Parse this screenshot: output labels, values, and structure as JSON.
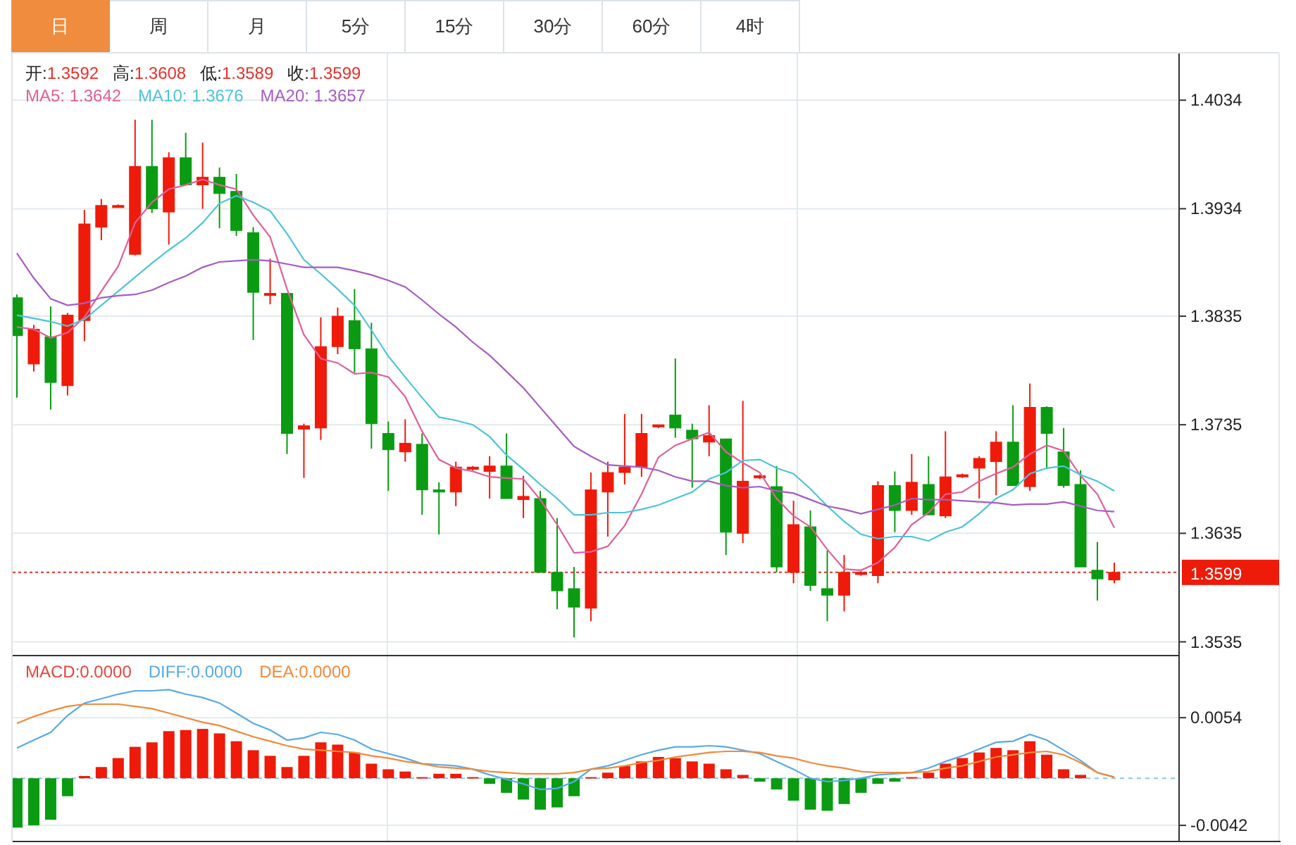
{
  "tabs": [
    {
      "label": "日",
      "selected": true
    },
    {
      "label": "周",
      "selected": false
    },
    {
      "label": "月",
      "selected": false
    },
    {
      "label": "5分",
      "selected": false
    },
    {
      "label": "15分",
      "selected": false
    },
    {
      "label": "30分",
      "selected": false
    },
    {
      "label": "60分",
      "selected": false
    },
    {
      "label": "4时",
      "selected": false
    }
  ],
  "price_chart": {
    "ohlc_legend": [
      {
        "label": "开:",
        "value": "1.3592"
      },
      {
        "label": "高:",
        "value": "1.3608"
      },
      {
        "label": "低:",
        "value": "1.3589"
      },
      {
        "label": "收:",
        "value": "1.3599"
      }
    ],
    "ma_legend": [
      {
        "text": "MA5: 1.3642",
        "color": "#e0609a"
      },
      {
        "text": "MA10: 1.3676",
        "color": "#4ec4d8"
      },
      {
        "text": "MA20: 1.3657",
        "color": "#a65cc4"
      }
    ],
    "current_price": "1.3599",
    "chart_data": {
      "type": "candlestick",
      "grid": true,
      "ylim": [
        1.3523,
        1.4077
      ],
      "yticks": [
        1.4034,
        1.3934,
        1.3835,
        1.3735,
        1.3635,
        1.3535
      ],
      "ref_lines": [
        {
          "axis": "y",
          "value": 1.3599
        }
      ],
      "ohlc": [
        [
          1.3852,
          1.3855,
          1.376,
          1.3817
        ],
        [
          1.3791,
          1.3827,
          1.3784,
          1.3823
        ],
        [
          1.3816,
          1.3844,
          1.3749,
          1.3774
        ],
        [
          1.3771,
          1.3838,
          1.3762,
          1.3836
        ],
        [
          1.3831,
          1.3933,
          1.3812,
          1.392
        ],
        [
          1.3917,
          1.3943,
          1.3905,
          1.3937
        ],
        [
          1.3936,
          1.3938,
          1.3935,
          1.3937
        ],
        [
          1.3892,
          1.4016,
          1.3891,
          1.3973
        ],
        [
          1.3973,
          1.4016,
          1.393,
          1.3934
        ],
        [
          1.3931,
          1.3986,
          1.3901,
          1.3981
        ],
        [
          1.3981,
          1.4004,
          1.3956,
          1.3956
        ],
        [
          1.3956,
          1.3995,
          1.3934,
          1.3963
        ],
        [
          1.3963,
          1.3972,
          1.3916,
          1.3948
        ],
        [
          1.395,
          1.3966,
          1.3909,
          1.3914
        ],
        [
          1.3912,
          1.3917,
          1.3813,
          1.3857
        ],
        [
          1.3855,
          1.3888,
          1.3846,
          1.3856
        ],
        [
          1.3856,
          1.3856,
          1.3708,
          1.3727
        ],
        [
          1.3731,
          1.3736,
          1.3686,
          1.3734
        ],
        [
          1.3732,
          1.3834,
          1.3721,
          1.3807
        ],
        [
          1.3807,
          1.3843,
          1.38,
          1.3835
        ],
        [
          1.3831,
          1.386,
          1.3783,
          1.3805
        ],
        [
          1.3805,
          1.3829,
          1.3713,
          1.3736
        ],
        [
          1.3727,
          1.3738,
          1.3674,
          1.3712
        ],
        [
          1.371,
          1.374,
          1.3701,
          1.3718
        ],
        [
          1.3717,
          1.3727,
          1.3652,
          1.3675
        ],
        [
          1.3675,
          1.3682,
          1.3634,
          1.3673
        ],
        [
          1.3673,
          1.3701,
          1.366,
          1.3696
        ],
        [
          1.3694,
          1.3697,
          1.3693,
          1.3696
        ],
        [
          1.3692,
          1.3706,
          1.3667,
          1.3697
        ],
        [
          1.3697,
          1.3727,
          1.3667,
          1.3667
        ],
        [
          1.3666,
          1.3688,
          1.3649,
          1.3669
        ],
        [
          1.3667,
          1.3674,
          1.3599,
          1.3599
        ],
        [
          1.3599,
          1.3649,
          1.3565,
          1.3582
        ],
        [
          1.3584,
          1.3604,
          1.3539,
          1.3567
        ],
        [
          1.3566,
          1.3691,
          1.3554,
          1.3675
        ],
        [
          1.3673,
          1.3701,
          1.3632,
          1.3691
        ],
        [
          1.3691,
          1.3745,
          1.368,
          1.3696
        ],
        [
          1.3696,
          1.3745,
          1.3687,
          1.3727
        ],
        [
          1.3733,
          1.3735,
          1.3732,
          1.3735
        ],
        [
          1.3744,
          1.3796,
          1.3723,
          1.3732
        ],
        [
          1.373,
          1.3736,
          1.3677,
          1.3722
        ],
        [
          1.3719,
          1.3753,
          1.3706,
          1.3725
        ],
        [
          1.3722,
          1.3722,
          1.3615,
          1.3636
        ],
        [
          1.3635,
          1.3757,
          1.3626,
          1.3683
        ],
        [
          1.3686,
          1.3689,
          1.3685,
          1.3688
        ],
        [
          1.3678,
          1.3697,
          1.3599,
          1.3604
        ],
        [
          1.3599,
          1.3665,
          1.3589,
          1.3643
        ],
        [
          1.3641,
          1.3656,
          1.3582,
          1.3587
        ],
        [
          1.3584,
          1.3619,
          1.3554,
          1.3578
        ],
        [
          1.3578,
          1.3615,
          1.3563,
          1.3599
        ],
        [
          1.3597,
          1.36,
          1.3596,
          1.3599
        ],
        [
          1.3596,
          1.3683,
          1.3589,
          1.3679
        ],
        [
          1.3679,
          1.3692,
          1.3636,
          1.3656
        ],
        [
          1.3656,
          1.3708,
          1.3652,
          1.3682
        ],
        [
          1.368,
          1.3706,
          1.3652,
          1.3652
        ],
        [
          1.3651,
          1.3729,
          1.3649,
          1.3687
        ],
        [
          1.3687,
          1.369,
          1.3686,
          1.3689
        ],
        [
          1.3695,
          1.3706,
          1.3667,
          1.3704
        ],
        [
          1.3701,
          1.3729,
          1.367,
          1.3719
        ],
        [
          1.3719,
          1.3753,
          1.3679,
          1.3679
        ],
        [
          1.3678,
          1.3773,
          1.3674,
          1.3751
        ],
        [
          1.3751,
          1.3752,
          1.3695,
          1.3727
        ],
        [
          1.371,
          1.3732,
          1.3677,
          1.3679
        ],
        [
          1.368,
          1.3693,
          1.3604,
          1.3604
        ],
        [
          1.3601,
          1.3627,
          1.3573,
          1.3593
        ],
        [
          1.3592,
          1.3608,
          1.3589,
          1.3599
        ]
      ],
      "series": [
        {
          "type": "line",
          "color": "#e0609a",
          "values": [
            1.3825,
            1.3823,
            1.3815,
            1.382,
            1.3834,
            1.3858,
            1.3881,
            1.3921,
            1.394,
            1.3952,
            1.3956,
            1.3961,
            1.3956,
            1.3952,
            1.3928,
            1.3908,
            1.386,
            1.3818,
            1.3796,
            1.3792,
            1.3782,
            1.3783,
            1.3779,
            1.3761,
            1.3729,
            1.3703,
            1.3695,
            1.3692,
            1.3687,
            1.3686,
            1.3685,
            1.3666,
            1.3643,
            1.3617,
            1.3618,
            1.3623,
            1.3642,
            1.3671,
            1.3705,
            1.3716,
            1.3722,
            1.3728,
            1.371,
            1.37,
            1.3691,
            1.3667,
            1.3651,
            1.3641,
            1.362,
            1.3602,
            1.3601,
            1.3608,
            1.3622,
            1.3643,
            1.3654,
            1.3671,
            1.3673,
            1.3683,
            1.369,
            1.3696,
            1.3708,
            1.3716,
            1.3711,
            1.3688,
            1.3671,
            1.364
          ]
        },
        {
          "type": "line",
          "color": "#4ec4d8",
          "values": [
            1.3836,
            1.3833,
            1.383,
            1.3826,
            1.3832,
            1.3845,
            1.3858,
            1.3871,
            1.3884,
            1.3896,
            1.3907,
            1.3921,
            1.3939,
            1.3946,
            1.394,
            1.3932,
            1.3911,
            1.3887,
            1.3874,
            1.386,
            1.3845,
            1.3822,
            1.3798,
            1.3779,
            1.376,
            1.3742,
            1.3739,
            1.3735,
            1.3724,
            1.3707,
            1.3694,
            1.368,
            1.3667,
            1.3652,
            1.3652,
            1.3654,
            1.3654,
            1.3657,
            1.3661,
            1.3667,
            1.3673,
            1.3685,
            1.3691,
            1.3702,
            1.3703,
            1.3695,
            1.369,
            1.3676,
            1.366,
            1.3646,
            1.3634,
            1.363,
            1.3632,
            1.3632,
            1.3628,
            1.3636,
            1.3641,
            1.3653,
            1.3667,
            1.3675,
            1.369,
            1.3695,
            1.3697,
            1.3689,
            1.3683,
            1.3674
          ]
        },
        {
          "type": "line",
          "color": "#a65cc4",
          "values": [
            1.3893,
            1.387,
            1.3851,
            1.3845,
            1.3847,
            1.3852,
            1.3854,
            1.3855,
            1.3859,
            1.3866,
            1.3872,
            1.388,
            1.3885,
            1.3886,
            1.3887,
            1.3886,
            1.3883,
            1.388,
            1.388,
            1.388,
            1.3877,
            1.3873,
            1.3868,
            1.3862,
            1.385,
            1.3837,
            1.3825,
            1.3811,
            1.3799,
            1.3784,
            1.3769,
            1.3751,
            1.3733,
            1.3715,
            1.3706,
            1.3698,
            1.3697,
            1.3696,
            1.3693,
            1.3687,
            1.3683,
            1.3683,
            1.3679,
            1.3677,
            1.3678,
            1.3674,
            1.3672,
            1.3666,
            1.366,
            1.3657,
            1.3653,
            1.3657,
            1.3661,
            1.3667,
            1.3666,
            1.3666,
            1.3665,
            1.3664,
            1.3663,
            1.3661,
            1.3662,
            1.3662,
            1.3664,
            1.366,
            1.3656,
            1.3655
          ]
        }
      ]
    }
  },
  "macd_chart": {
    "legend": [
      {
        "text": "MACD:0.0000",
        "color": "#e8453c"
      },
      {
        "text": "DIFF:0.0000",
        "color": "#5aaae6"
      },
      {
        "text": "DEA:0.0000",
        "color": "#f08a3c"
      }
    ],
    "chart_data": {
      "type": "bar",
      "grid": true,
      "ylim": [
        -0.0057,
        0.011
      ],
      "yticks": [
        0.0054,
        -0.0042
      ],
      "ref_lines": [
        {
          "axis": "y",
          "value": 0
        }
      ],
      "series": [
        {
          "colors": [
            "#0a9b12",
            "#0a9b12",
            "#0a9b12",
            "#0a9b12",
            "#ee1a0a",
            "#ee1a0a",
            "#ee1a0a",
            "#ee1a0a",
            "#ee1a0a",
            "#ee1a0a",
            "#ee1a0a",
            "#ee1a0a",
            "#ee1a0a",
            "#ee1a0a",
            "#ee1a0a",
            "#ee1a0a",
            "#ee1a0a",
            "#ee1a0a",
            "#ee1a0a",
            "#ee1a0a",
            "#ee1a0a",
            "#ee1a0a",
            "#ee1a0a",
            "#ee1a0a",
            "#ee1a0a",
            "#ee1a0a",
            "#ee1a0a",
            "#ee1a0a",
            "#0a9b12",
            "#0a9b12",
            "#0a9b12",
            "#0a9b12",
            "#0a9b12",
            "#0a9b12",
            "#ee1a0a",
            "#ee1a0a",
            "#ee1a0a",
            "#ee1a0a",
            "#ee1a0a",
            "#ee1a0a",
            "#ee1a0a",
            "#ee1a0a",
            "#ee1a0a",
            "#ee1a0a",
            "#0a9b12",
            "#0a9b12",
            "#0a9b12",
            "#0a9b12",
            "#0a9b12",
            "#0a9b12",
            "#0a9b12",
            "#0a9b12",
            "#0a9b12",
            "#ee1a0a",
            "#ee1a0a",
            "#ee1a0a",
            "#ee1a0a",
            "#ee1a0a",
            "#ee1a0a",
            "#ee1a0a",
            "#ee1a0a",
            "#ee1a0a",
            "#ee1a0a",
            "#ee1a0a",
            "#ee1a0a",
            "#ee1a0a"
          ],
          "values": [
            -0.0044,
            -0.0042,
            -0.0037,
            -0.0016,
            0.0002,
            0.001,
            0.0018,
            0.0028,
            0.0032,
            0.0042,
            0.0043,
            0.0044,
            0.004,
            0.0033,
            0.0025,
            0.002,
            0.001,
            0.002,
            0.0032,
            0.003,
            0.0023,
            0.0013,
            0.0008,
            0.0006,
            0.0001,
            0.0004,
            0.0004,
            0.0001,
            -0.0005,
            -0.0013,
            -0.0019,
            -0.0028,
            -0.0026,
            -0.0016,
            0.0001,
            0.0005,
            0.0011,
            0.0015,
            0.0019,
            0.0018,
            0.0015,
            0.0013,
            0.0008,
            0.0003,
            -0.0003,
            -0.001,
            -0.002,
            -0.0028,
            -0.0029,
            -0.0023,
            -0.0013,
            -0.0005,
            -0.0003,
            0.0001,
            0.0005,
            0.0013,
            0.0018,
            0.0023,
            0.0027,
            0.0025,
            0.0033,
            0.0021,
            0.0008,
            0.0003,
            null,
            null
          ]
        },
        {
          "type": "line",
          "color": "#5aaae6",
          "values": [
            0.0027,
            0.0034,
            0.0041,
            0.0056,
            0.0067,
            0.0071,
            0.0075,
            0.0078,
            0.0078,
            0.0079,
            0.0075,
            0.0072,
            0.0067,
            0.0058,
            0.0049,
            0.0043,
            0.0034,
            0.0036,
            0.0041,
            0.0039,
            0.0034,
            0.0026,
            0.0022,
            0.0018,
            0.0013,
            0.0012,
            0.0011,
            0.0008,
            0.0003,
            -0.0001,
            -0.0005,
            -0.001,
            -0.0009,
            -0.0003,
            0.0008,
            0.0011,
            0.0016,
            0.0021,
            0.0025,
            0.0028,
            0.0028,
            0.0029,
            0.0028,
            0.0025,
            0.0022,
            0.0015,
            0.0008,
            0.0,
            -0.0003,
            -0.0002,
            0.0,
            0.0003,
            0.0004,
            0.0005,
            0.0009,
            0.0015,
            0.002,
            0.0026,
            0.0032,
            0.0033,
            0.0039,
            0.0034,
            0.0025,
            0.0016,
            0.0005,
            0.0001
          ]
        },
        {
          "type": "line",
          "color": "#f08a3c",
          "values": [
            0.0049,
            0.0055,
            0.006,
            0.0064,
            0.0066,
            0.0066,
            0.0066,
            0.0064,
            0.0062,
            0.0058,
            0.0054,
            0.005,
            0.0047,
            0.0042,
            0.0037,
            0.0033,
            0.0029,
            0.0026,
            0.0025,
            0.0024,
            0.0023,
            0.002,
            0.0018,
            0.0015,
            0.0013,
            0.001,
            0.0009,
            0.0008,
            0.0006,
            0.0005,
            0.0004,
            0.0004,
            0.0004,
            0.0005,
            0.0008,
            0.0009,
            0.0011,
            0.0014,
            0.0016,
            0.0019,
            0.0021,
            0.0023,
            0.0024,
            0.0024,
            0.0023,
            0.002,
            0.0018,
            0.0014,
            0.0011,
            0.0009,
            0.0006,
            0.0005,
            0.0005,
            0.0005,
            0.0006,
            0.0009,
            0.0011,
            0.0015,
            0.0019,
            0.0021,
            0.0023,
            0.0024,
            0.0021,
            0.0014,
            0.0005,
            0.0001
          ]
        }
      ]
    }
  }
}
